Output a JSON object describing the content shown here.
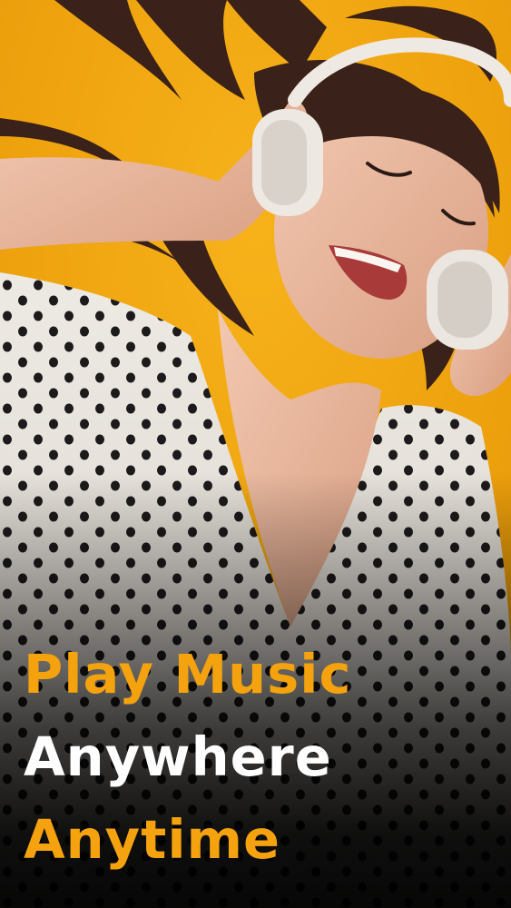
{
  "promo": {
    "line1": "Play Music",
    "line2": "Anywhere",
    "line3": "Anytime"
  },
  "colors": {
    "background": "#f0a70f",
    "accent": "#f5a20f",
    "text_light": "#ffffff",
    "shade": "#000000"
  },
  "image": {
    "icons": [
      "headphones-icon"
    ]
  }
}
